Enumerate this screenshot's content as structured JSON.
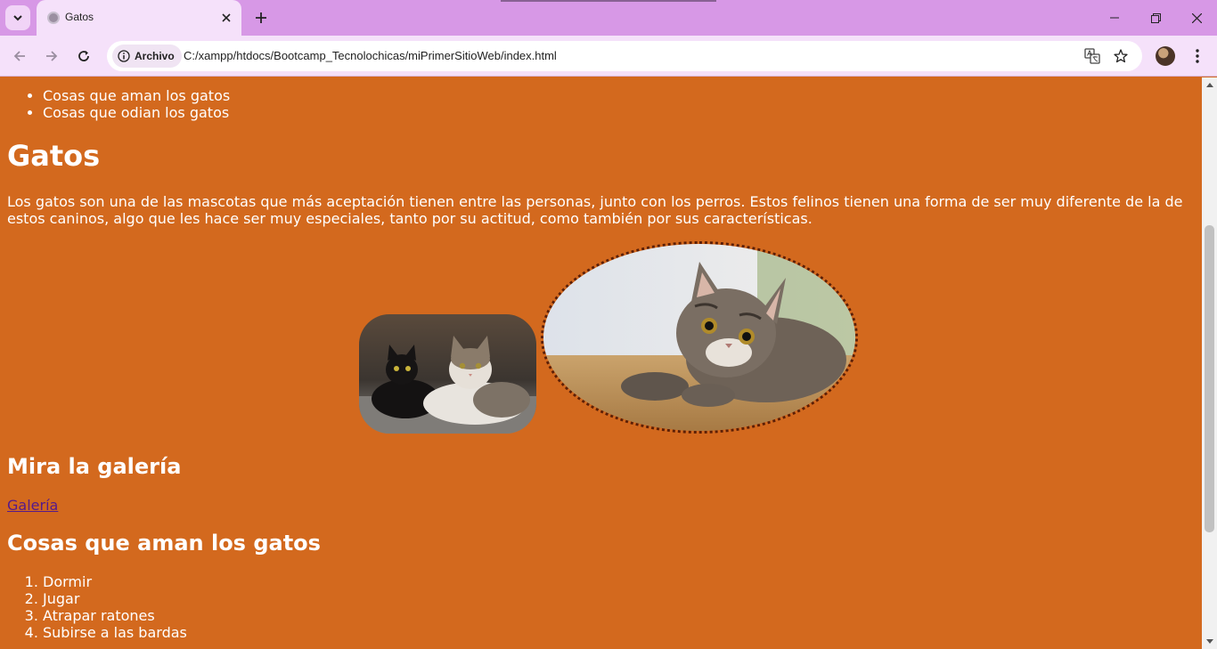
{
  "browser": {
    "tab_title": "Gatos",
    "security_chip": "Archivo",
    "url": "C:/xampp/htdocs/Bootcamp_Tecnolochicas/miPrimerSitioWeb/index.html"
  },
  "page": {
    "top_list": [
      "Cosas que aman los gatos",
      "Cosas que odian los gatos"
    ],
    "title": "Gatos",
    "intro": "Los gatos son una de las mascotas que más aceptación tienen entre las personas, junto con los perros. Estos felinos tienen una forma de ser muy diferente de la de estos caninos, algo que les hace ser muy especiales, tanto por su actitud, como también por sus características.",
    "gallery_heading": "Mira la galería",
    "gallery_link": "Galería",
    "love_heading": "Cosas que aman los gatos",
    "love_list": [
      "Dormir",
      "Jugar",
      "Atrapar ratones",
      "Subirse a las bardas"
    ]
  },
  "colors": {
    "page_background": "#d3691e",
    "tab_strip": "#d798e6",
    "toolbar": "#f5e1fa",
    "link": "#551a8b"
  }
}
